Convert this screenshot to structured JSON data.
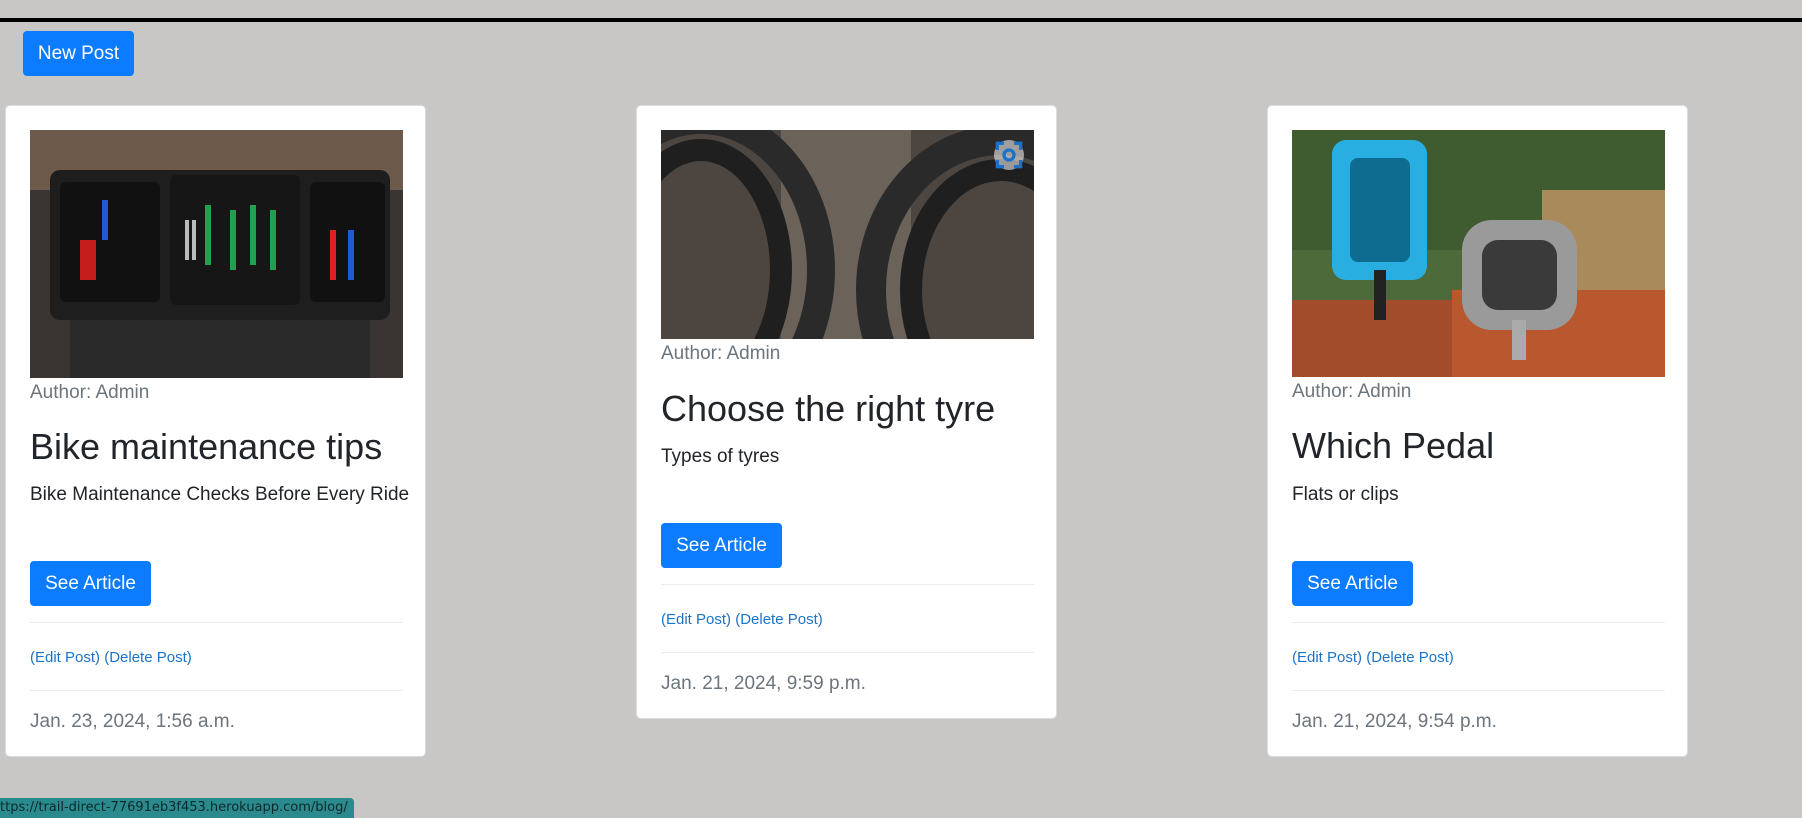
{
  "toolbar": {
    "new_post_label": "New Post"
  },
  "posts": [
    {
      "author": "Author: Admin",
      "title": "Bike maintenance tips",
      "excerpt": "Bike Maintenance Checks Before Every Ride",
      "cta": "See Article",
      "edit": "(Edit Post)",
      "delete": "(Delete Post)",
      "date": "Jan. 23, 2024, 1:56 a.m.",
      "image_icon": "toolbox-photo"
    },
    {
      "author": "Author: Admin",
      "title": "Choose the right tyre",
      "excerpt": "Types of tyres",
      "cta": "See Article",
      "edit": "(Edit Post)",
      "delete": "(Delete Post)",
      "date": "Jan. 21, 2024, 9:59 p.m.",
      "image_icon": "tyres-photo"
    },
    {
      "author": "Author: Admin",
      "title": "Which Pedal",
      "excerpt": "Flats or clips",
      "cta": "See Article",
      "edit": "(Edit Post)",
      "delete": "(Delete Post)",
      "date": "Jan. 21, 2024, 9:54 p.m.",
      "image_icon": "pedals-photo"
    }
  ],
  "status_bar": {
    "url": "ttps://trail-direct-77691eb3f453.herokuapp.com/blog/"
  },
  "colors": {
    "primary": "#0b7bff",
    "background": "#c9c6c6",
    "link": "#1a73c8"
  }
}
